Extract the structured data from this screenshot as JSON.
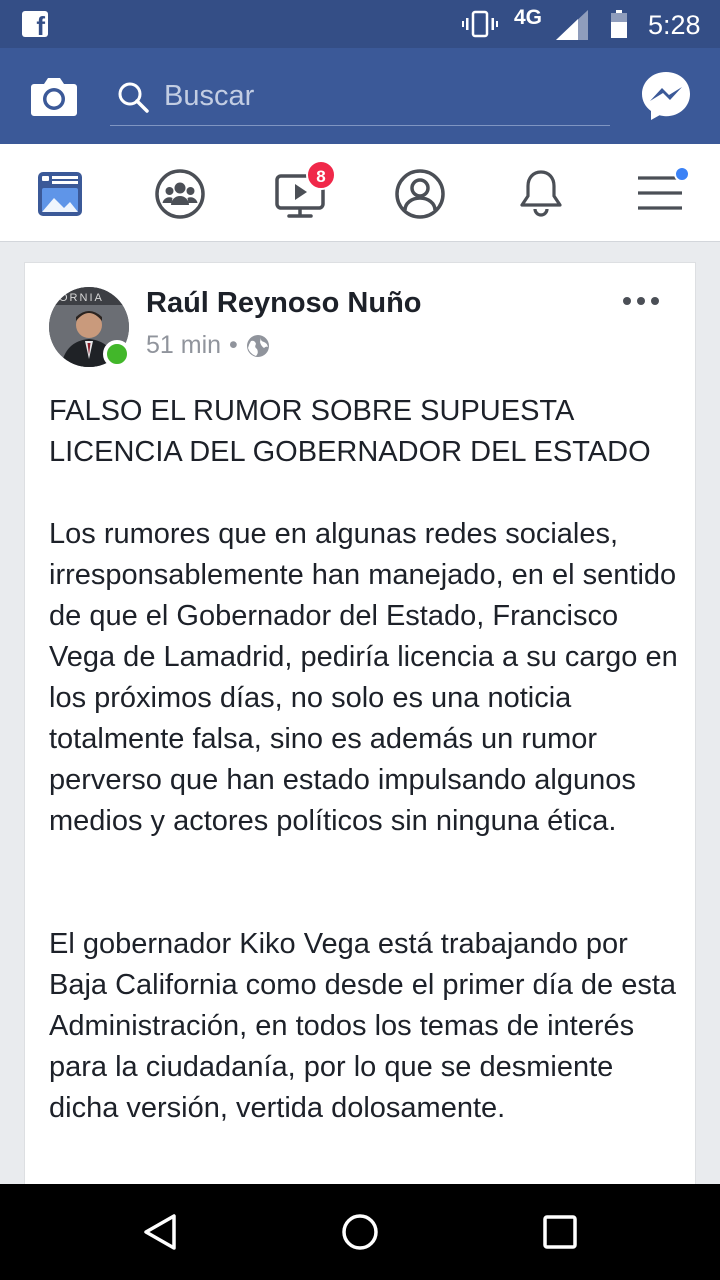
{
  "status_bar": {
    "app_icon": "facebook-f-icon",
    "network": "4G",
    "time": "5:28",
    "icons": [
      "vibrate-icon",
      "signal-icon",
      "battery-icon"
    ]
  },
  "header": {
    "camera_icon": "camera-icon",
    "search_placeholder": "Buscar",
    "search_icon": "search-icon",
    "messenger_icon": "messenger-icon"
  },
  "nav_tabs": {
    "items": [
      {
        "icon": "news-feed-icon",
        "active": true
      },
      {
        "icon": "groups-icon"
      },
      {
        "icon": "watch-video-icon",
        "badge": "8"
      },
      {
        "icon": "profile-icon"
      },
      {
        "icon": "notifications-bell-icon"
      },
      {
        "icon": "menu-icon",
        "dot": true
      }
    ],
    "watch_badge": "8"
  },
  "post": {
    "author": "Raúl Reynoso Nuño",
    "time": "51 min",
    "separator": "•",
    "audience_icon": "globe-icon",
    "more_icon": "more-options-icon",
    "headline": "FALSO EL RUMOR SOBRE SUPUESTA\nLICENCIA DEL GOBERNADOR DEL ESTADO",
    "paragraph_1": "Los rumores que en algunas redes sociales, irresponsablemente han manejado, en el sentido de que el Gobernador del Estado, Francisco Vega de Lamadrid, pediría licencia a su cargo en los próximos días, no solo es una noticia totalmente falsa, sino es además un rumor perverso que han estado impulsando algunos medios y actores políticos sin ninguna ética.",
    "paragraph_2": "El gobernador Kiko  Vega está trabajando por Baja California como desde el primer día de esta Administración, en todos los temas de interés para la ciudadanía, por lo que se desmiente dicha versión, vertida dolosamente."
  },
  "android_nav": [
    "back-icon",
    "home-icon",
    "recents-icon"
  ],
  "colors": {
    "brand": "#3b5998",
    "status_bar": "#344e86",
    "badge": "#f02849",
    "online": "#42b72a"
  }
}
